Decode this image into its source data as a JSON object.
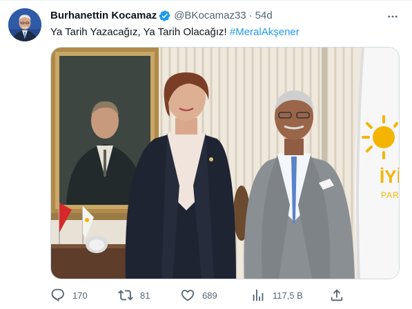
{
  "author": {
    "name": "Burhanettin Kocamaz",
    "handle": "@BKocamaz33",
    "separator": "·",
    "time": "54d",
    "verified_color": "#1d9bf0"
  },
  "tweet": {
    "text": "Ya Tarih Yazacağız, Ya Tarih Olacağız! ",
    "hashtag": "#MeralAkşener"
  },
  "photo": {
    "party_logo_text": "İYİ",
    "party_logo_sub": "PARTİ"
  },
  "actions": {
    "replies": "170",
    "retweets": "81",
    "likes": "689",
    "views": "117,5 B"
  },
  "icons": {
    "reply": "reply-icon",
    "retweet": "retweet-icon",
    "like": "heart-icon",
    "views": "views-chart-icon",
    "share": "share-icon",
    "more": "more-options-icon"
  },
  "colors": {
    "link": "#1d9bf0",
    "secondary_text": "#536471",
    "primary_text": "#0f1419"
  }
}
